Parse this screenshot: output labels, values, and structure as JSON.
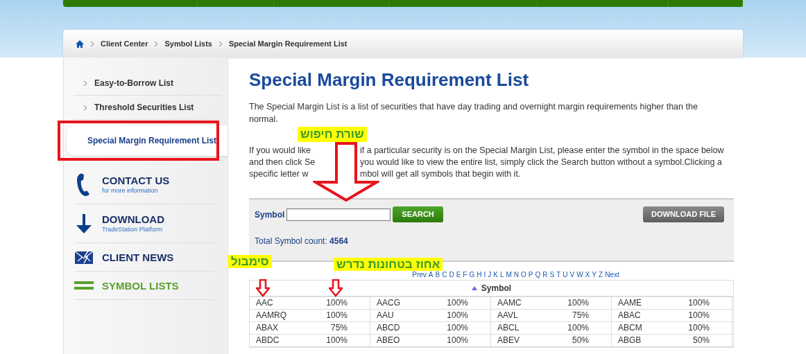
{
  "breadcrumb": [
    "Client Center",
    "Symbol Lists",
    "Special Margin Requirement List"
  ],
  "sidebar": {
    "items": [
      {
        "label": "Easy-to-Borrow List",
        "selected": false
      },
      {
        "label": "Threshold Securities List",
        "selected": false
      },
      {
        "label": "Special Margin Requirement List",
        "selected": true
      }
    ],
    "links": [
      {
        "kind": "phone",
        "title": "CONTACT US",
        "subtitle": "for more information",
        "selected": false
      },
      {
        "kind": "download",
        "title": "DOWNLOAD",
        "subtitle": "TradeStation Platform",
        "selected": false
      },
      {
        "kind": "news",
        "title": "CLIENT NEWS",
        "selected": false
      },
      {
        "kind": "lists",
        "title": "SYMBOL LISTS",
        "selected": true
      }
    ]
  },
  "title": "Special Margin Requirement List",
  "intro": "The Special Margin List is a list of securities that have day trading and overnight margin requirements higher than the normal.",
  "instructions_lines": [
    [
      "If you would like",
      "if a particular security is on the Special Margin List, please enter the symbol in the space below"
    ],
    [
      "and then click Se",
      "you would like to view the entire list, simply click the Search button without a symbol.Clicking a"
    ],
    [
      "specific letter w",
      "mbol will get all symbols that begin with it."
    ]
  ],
  "search": {
    "label": "Symbol",
    "button": "SEARCH",
    "download": "DOWNLOAD FILE",
    "count_label": "Total Symbol count:",
    "count": "4564"
  },
  "letters": [
    "Prev",
    "A",
    "B",
    "C",
    "D",
    "E",
    "F",
    "G",
    "H",
    "I",
    "J",
    "K",
    "L",
    "M",
    "N",
    "O",
    "P",
    "Q",
    "R",
    "S",
    "T",
    "U",
    "V",
    "W",
    "X",
    "Y",
    "Z",
    "Next"
  ],
  "table": {
    "header": "Symbol",
    "rows": [
      [
        {
          "symbol": "AAC",
          "percent": "100%"
        },
        {
          "symbol": "AACG",
          "percent": "100%"
        },
        {
          "symbol": "AAMC",
          "percent": "100%"
        },
        {
          "symbol": "AAME",
          "percent": "100%"
        }
      ],
      [
        {
          "symbol": "AAMRQ",
          "percent": "100%"
        },
        {
          "symbol": "AAU",
          "percent": "100%"
        },
        {
          "symbol": "AAVL",
          "percent": "75%"
        },
        {
          "symbol": "ABAC",
          "percent": "100%"
        }
      ],
      [
        {
          "symbol": "ABAX",
          "percent": "75%"
        },
        {
          "symbol": "ABCD",
          "percent": "100%"
        },
        {
          "symbol": "ABCL",
          "percent": "100%"
        },
        {
          "symbol": "ABCM",
          "percent": "100%"
        }
      ],
      [
        {
          "symbol": "ABDC",
          "percent": "100%"
        },
        {
          "symbol": "ABEO",
          "percent": "100%"
        },
        {
          "symbol": "ABEV",
          "percent": "50%"
        },
        {
          "symbol": "ABGB",
          "percent": "50%"
        }
      ]
    ]
  },
  "annotations": {
    "search_label": "שורת חיפוש",
    "symbol_label": "סימבול",
    "percent_label": "אחוז בטחונות נדרש"
  }
}
